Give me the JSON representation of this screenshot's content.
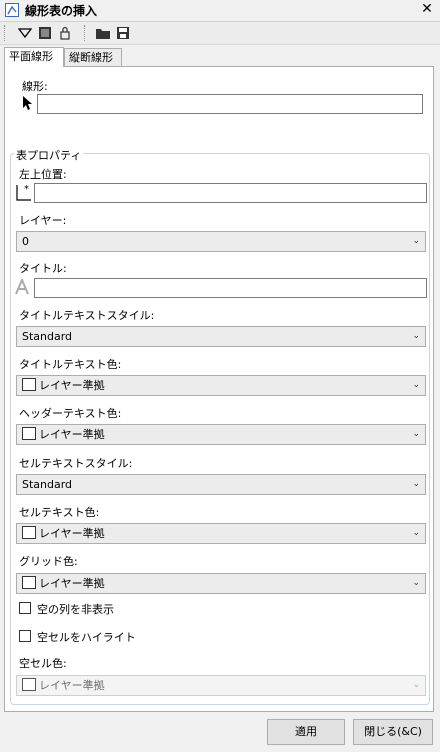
{
  "window": {
    "title": "線形表の挿入",
    "close_label": "✕"
  },
  "tabs": [
    {
      "label": "平面線形"
    },
    {
      "label": "縦断線形"
    }
  ],
  "alignment": {
    "label": "線形:",
    "value": ""
  },
  "table_properties": {
    "legend": "表プロパティ",
    "upper_left": {
      "label": "左上位置:",
      "value": ""
    },
    "layer": {
      "label": "レイヤー:",
      "value": "0"
    },
    "title": {
      "label": "タイトル:",
      "value": ""
    },
    "title_text_style": {
      "label": "タイトルテキストスタイル:",
      "value": "Standard"
    },
    "title_text_color": {
      "label": "タイトルテキスト色:",
      "value": "レイヤー準拠"
    },
    "header_text_color": {
      "label": "ヘッダーテキスト色:",
      "value": "レイヤー準拠"
    },
    "cell_text_style": {
      "label": "セルテキストスタイル:",
      "value": "Standard"
    },
    "cell_text_color": {
      "label": "セルテキスト色:",
      "value": "レイヤー準拠"
    },
    "grid_color": {
      "label": "グリッド色:",
      "value": "レイヤー準拠"
    },
    "hide_empty_columns": {
      "label": "空の列を非表示"
    },
    "highlight_empty_cells": {
      "label": "空セルをハイライト"
    },
    "empty_cell_color": {
      "label": "空セル色:",
      "value": "レイヤー準拠"
    }
  },
  "buttons": {
    "apply": "適用",
    "close": "閉じる(&C)"
  },
  "colors": {
    "accent": "#3b6ab5",
    "group_border": "#c6d6e8"
  }
}
